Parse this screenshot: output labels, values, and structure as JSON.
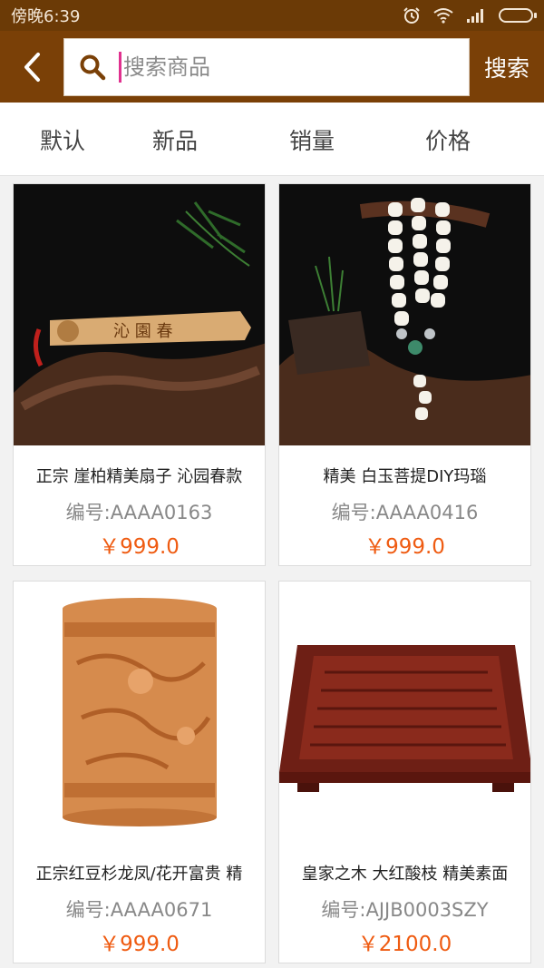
{
  "status_bar": {
    "time": "傍晚6:39"
  },
  "search": {
    "placeholder": "搜索商品",
    "value": "",
    "button_label": "搜索"
  },
  "sort_tabs": [
    {
      "label": "默认"
    },
    {
      "label": "新品"
    },
    {
      "label": "销量"
    },
    {
      "label": "价格"
    }
  ],
  "products": [
    {
      "title": "正宗 崖柏精美扇子 沁园春款",
      "code": "编号:AAAA0163",
      "price": "￥999.0"
    },
    {
      "title": "精美 白玉菩提DIY玛瑙",
      "code": "编号:AAAA0416",
      "price": "￥999.0"
    },
    {
      "title": "正宗红豆杉龙凤/花开富贵 精",
      "code": "编号:AAAA0671",
      "price": "￥999.0"
    },
    {
      "title": "皇家之木 大红酸枝 精美素面",
      "code": "编号:AJJB0003SZY",
      "price": "￥2100.0"
    }
  ],
  "colors": {
    "header_bg": "#7a4007",
    "status_bg": "#6b3a06",
    "price": "#ef5b11"
  }
}
